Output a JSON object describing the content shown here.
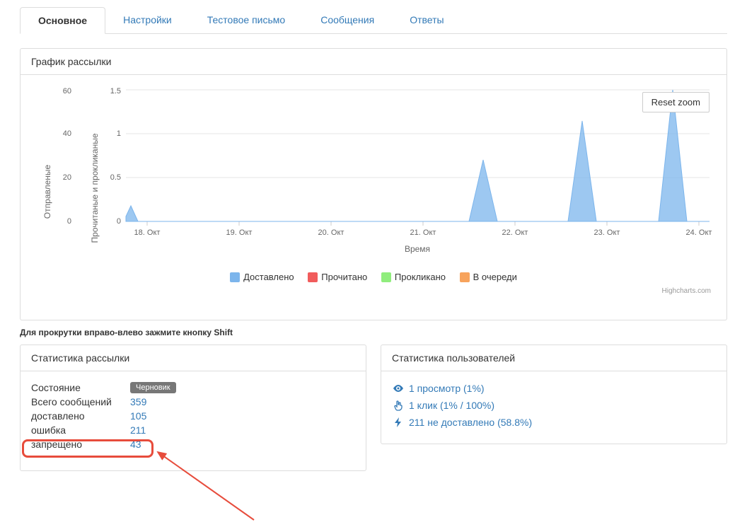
{
  "tabs": [
    "Основное",
    "Настройки",
    "Тестовое письмо",
    "Сообщения",
    "Ответы"
  ],
  "chart_panel": {
    "title": "График рассылки",
    "reset_zoom": "Reset zoom",
    "x_axis_title": "Время",
    "y_left_label": "Отправленые",
    "y_right_label": "Прочитаные и прокликаные",
    "credits": "Highcharts.com",
    "legend": [
      "Доставлено",
      "Прочитано",
      "Прокликано",
      "В очереди"
    ],
    "legend_colors": [
      "#7cb5ec",
      "#f15c5c",
      "#90ed7d",
      "#f7a35c"
    ]
  },
  "chart_data": {
    "type": "line",
    "x_categories": [
      "18. Окт",
      "19. Окт",
      "20. Окт",
      "21. Окт",
      "22. Окт",
      "23. Окт",
      "24. Окт"
    ],
    "y_left": {
      "label": "Отправленые",
      "ticks": [
        0,
        20,
        40,
        60
      ],
      "range": [
        0,
        60
      ]
    },
    "y_right": {
      "label": "Прочитаные и прокликаные",
      "ticks": [
        0,
        0.5,
        1,
        1.5
      ],
      "range": [
        0,
        1.5
      ]
    },
    "series": [
      {
        "name": "Доставлено",
        "axis": "left",
        "color": "#7cb5ec",
        "points": [
          {
            "x": "17.5",
            "y": 8
          },
          {
            "x": "18. Окт",
            "y": 0
          },
          {
            "x": "19. Окт",
            "y": 0
          },
          {
            "x": "20. Окт",
            "y": 0
          },
          {
            "x": "21. Окт",
            "y": 0
          },
          {
            "x": "21.7",
            "y": 28
          },
          {
            "x": "22. Окт",
            "y": 0
          },
          {
            "x": "22.75",
            "y": 47
          },
          {
            "x": "23. Окт",
            "y": 0
          },
          {
            "x": "23.7",
            "y": 60
          },
          {
            "x": "24. Окт",
            "y": 0
          }
        ]
      },
      {
        "name": "Прочитано",
        "axis": "right",
        "color": "#f15c5c",
        "points": []
      },
      {
        "name": "Прокликано",
        "axis": "right",
        "color": "#90ed7d",
        "points": []
      },
      {
        "name": "В очереди",
        "axis": "left",
        "color": "#f7a35c",
        "points": []
      }
    ],
    "xlabel": "Время"
  },
  "scroll_hint": "Для прокрутки вправо-влево зажмите кнопку Shift",
  "stats_panel": {
    "title": "Статистика рассылки",
    "rows": [
      {
        "label": "Состояние",
        "badge": "Черновик"
      },
      {
        "label": "Всего сообщений",
        "value": "359"
      },
      {
        "label": "доставлено",
        "value": "105"
      },
      {
        "label": "ошибка",
        "value": "211",
        "highlighted": true
      },
      {
        "label": "запрещено",
        "value": "43"
      }
    ]
  },
  "user_stats_panel": {
    "title": "Статистика пользователей",
    "rows": [
      {
        "icon": "eye",
        "text": "1 просмотр (1%)"
      },
      {
        "icon": "hand",
        "text": "1 клик (1% / 100%)"
      },
      {
        "icon": "bolt",
        "text": "211 не доставлено (58.8%)"
      }
    ]
  }
}
